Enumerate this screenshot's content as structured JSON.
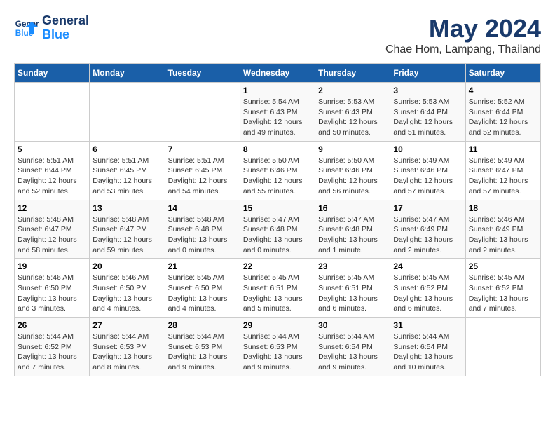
{
  "logo": {
    "line1": "General",
    "line2": "Blue"
  },
  "title": "May 2024",
  "subtitle": "Chae Hom, Lampang, Thailand",
  "headers": [
    "Sunday",
    "Monday",
    "Tuesday",
    "Wednesday",
    "Thursday",
    "Friday",
    "Saturday"
  ],
  "weeks": [
    [
      {
        "day": "",
        "info": ""
      },
      {
        "day": "",
        "info": ""
      },
      {
        "day": "",
        "info": ""
      },
      {
        "day": "1",
        "info": "Sunrise: 5:54 AM\nSunset: 6:43 PM\nDaylight: 12 hours\nand 49 minutes."
      },
      {
        "day": "2",
        "info": "Sunrise: 5:53 AM\nSunset: 6:43 PM\nDaylight: 12 hours\nand 50 minutes."
      },
      {
        "day": "3",
        "info": "Sunrise: 5:53 AM\nSunset: 6:44 PM\nDaylight: 12 hours\nand 51 minutes."
      },
      {
        "day": "4",
        "info": "Sunrise: 5:52 AM\nSunset: 6:44 PM\nDaylight: 12 hours\nand 52 minutes."
      }
    ],
    [
      {
        "day": "5",
        "info": "Sunrise: 5:51 AM\nSunset: 6:44 PM\nDaylight: 12 hours\nand 52 minutes."
      },
      {
        "day": "6",
        "info": "Sunrise: 5:51 AM\nSunset: 6:45 PM\nDaylight: 12 hours\nand 53 minutes."
      },
      {
        "day": "7",
        "info": "Sunrise: 5:51 AM\nSunset: 6:45 PM\nDaylight: 12 hours\nand 54 minutes."
      },
      {
        "day": "8",
        "info": "Sunrise: 5:50 AM\nSunset: 6:46 PM\nDaylight: 12 hours\nand 55 minutes."
      },
      {
        "day": "9",
        "info": "Sunrise: 5:50 AM\nSunset: 6:46 PM\nDaylight: 12 hours\nand 56 minutes."
      },
      {
        "day": "10",
        "info": "Sunrise: 5:49 AM\nSunset: 6:46 PM\nDaylight: 12 hours\nand 57 minutes."
      },
      {
        "day": "11",
        "info": "Sunrise: 5:49 AM\nSunset: 6:47 PM\nDaylight: 12 hours\nand 57 minutes."
      }
    ],
    [
      {
        "day": "12",
        "info": "Sunrise: 5:48 AM\nSunset: 6:47 PM\nDaylight: 12 hours\nand 58 minutes."
      },
      {
        "day": "13",
        "info": "Sunrise: 5:48 AM\nSunset: 6:47 PM\nDaylight: 12 hours\nand 59 minutes."
      },
      {
        "day": "14",
        "info": "Sunrise: 5:48 AM\nSunset: 6:48 PM\nDaylight: 13 hours\nand 0 minutes."
      },
      {
        "day": "15",
        "info": "Sunrise: 5:47 AM\nSunset: 6:48 PM\nDaylight: 13 hours\nand 0 minutes."
      },
      {
        "day": "16",
        "info": "Sunrise: 5:47 AM\nSunset: 6:48 PM\nDaylight: 13 hours\nand 1 minute."
      },
      {
        "day": "17",
        "info": "Sunrise: 5:47 AM\nSunset: 6:49 PM\nDaylight: 13 hours\nand 2 minutes."
      },
      {
        "day": "18",
        "info": "Sunrise: 5:46 AM\nSunset: 6:49 PM\nDaylight: 13 hours\nand 2 minutes."
      }
    ],
    [
      {
        "day": "19",
        "info": "Sunrise: 5:46 AM\nSunset: 6:50 PM\nDaylight: 13 hours\nand 3 minutes."
      },
      {
        "day": "20",
        "info": "Sunrise: 5:46 AM\nSunset: 6:50 PM\nDaylight: 13 hours\nand 4 minutes."
      },
      {
        "day": "21",
        "info": "Sunrise: 5:45 AM\nSunset: 6:50 PM\nDaylight: 13 hours\nand 4 minutes."
      },
      {
        "day": "22",
        "info": "Sunrise: 5:45 AM\nSunset: 6:51 PM\nDaylight: 13 hours\nand 5 minutes."
      },
      {
        "day": "23",
        "info": "Sunrise: 5:45 AM\nSunset: 6:51 PM\nDaylight: 13 hours\nand 6 minutes."
      },
      {
        "day": "24",
        "info": "Sunrise: 5:45 AM\nSunset: 6:52 PM\nDaylight: 13 hours\nand 6 minutes."
      },
      {
        "day": "25",
        "info": "Sunrise: 5:45 AM\nSunset: 6:52 PM\nDaylight: 13 hours\nand 7 minutes."
      }
    ],
    [
      {
        "day": "26",
        "info": "Sunrise: 5:44 AM\nSunset: 6:52 PM\nDaylight: 13 hours\nand 7 minutes."
      },
      {
        "day": "27",
        "info": "Sunrise: 5:44 AM\nSunset: 6:53 PM\nDaylight: 13 hours\nand 8 minutes."
      },
      {
        "day": "28",
        "info": "Sunrise: 5:44 AM\nSunset: 6:53 PM\nDaylight: 13 hours\nand 9 minutes."
      },
      {
        "day": "29",
        "info": "Sunrise: 5:44 AM\nSunset: 6:53 PM\nDaylight: 13 hours\nand 9 minutes."
      },
      {
        "day": "30",
        "info": "Sunrise: 5:44 AM\nSunset: 6:54 PM\nDaylight: 13 hours\nand 9 minutes."
      },
      {
        "day": "31",
        "info": "Sunrise: 5:44 AM\nSunset: 6:54 PM\nDaylight: 13 hours\nand 10 minutes."
      },
      {
        "day": "",
        "info": ""
      }
    ]
  ]
}
